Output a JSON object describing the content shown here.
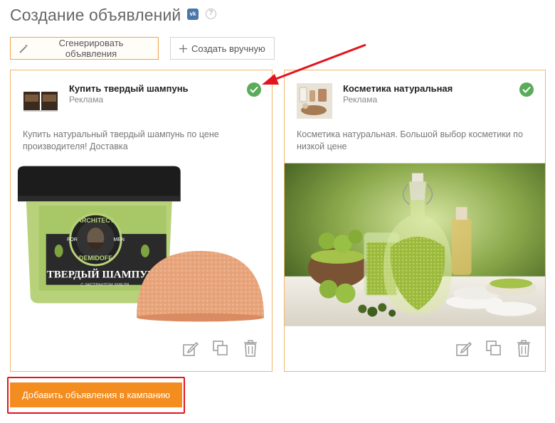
{
  "page": {
    "title": "Создание объявлений",
    "vk_badge": "vk",
    "help_glyph": "?"
  },
  "toolbar": {
    "generate_label": "Сгенерировать объявления",
    "manual_label": "Создать вручную"
  },
  "cards": [
    {
      "title": "Купить твердый шампунь",
      "subtitle": "Реклама",
      "description": "Купить натуральный твердый шампунь по цене производителя! Доставка",
      "status": "approved",
      "image_subject": "solid-shampoo-jar",
      "image_text": {
        "brand": "DEMIDOFF",
        "badge_top": "ARCHITECT",
        "badge_side_left": "FOR",
        "badge_side_right": "MEN",
        "product": "ТВЕРДЫЙ ШАМПУНЬ",
        "subline": "С ЭКСТРАКТОМ ХМЕЛЯ"
      }
    },
    {
      "title": "Косметика натуральная",
      "subtitle": "Реклама",
      "description": "Косметика натуральная. Большой выбор косметики по низкой цене",
      "status": "approved",
      "image_subject": "spa-cosmetics-bottles"
    }
  ],
  "actions": {
    "add_to_campaign_label": "Добавить объявления в кампанию"
  },
  "colors": {
    "accent_orange": "#f38d1f",
    "card_border": "#f0b66a",
    "approved_green": "#5aab5a",
    "annotation_red": "#e3141e",
    "vk_blue": "#4a76a8"
  }
}
